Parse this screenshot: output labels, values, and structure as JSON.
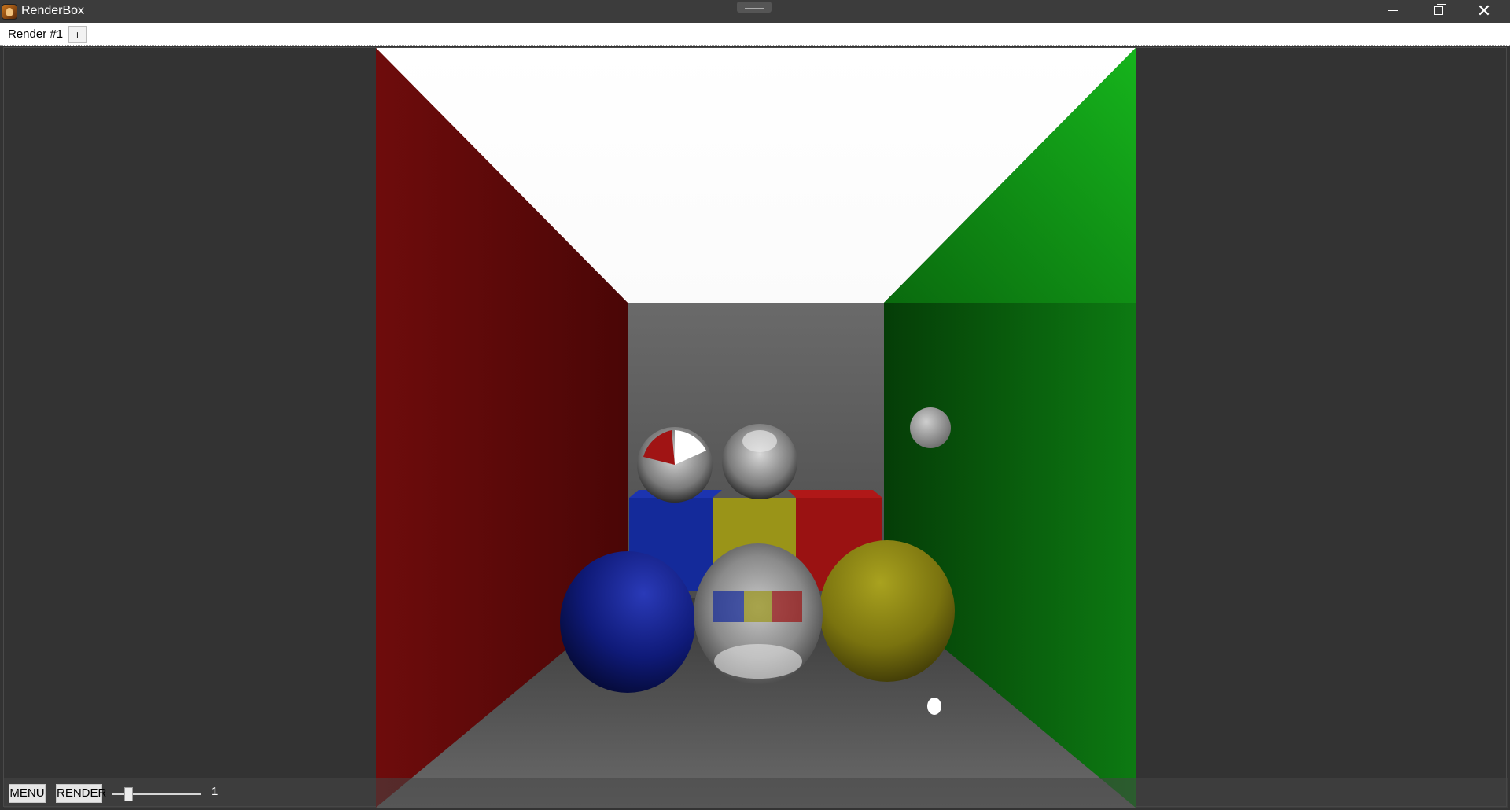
{
  "window": {
    "title": "RenderBox",
    "minimize_icon": "minimize-icon",
    "maximize_icon": "restore-icon",
    "close_icon": "close-icon"
  },
  "tabs": [
    {
      "label": "Render #1",
      "active": true
    }
  ],
  "add_tab_label": "+",
  "scene": {
    "description_colors": {
      "left_wall": "#7a0f0f",
      "right_wall": "#0f8a16",
      "ceiling": "#ffffff",
      "floor_back": "#5a5a5a",
      "blue": "#14208a",
      "yellow": "#8c8514",
      "red": "#8a1010"
    }
  },
  "toolbar": {
    "menu_label": "MENU",
    "render_label": "RENDER",
    "samples_slider_value": "1",
    "slider_fraction": 0.15
  }
}
